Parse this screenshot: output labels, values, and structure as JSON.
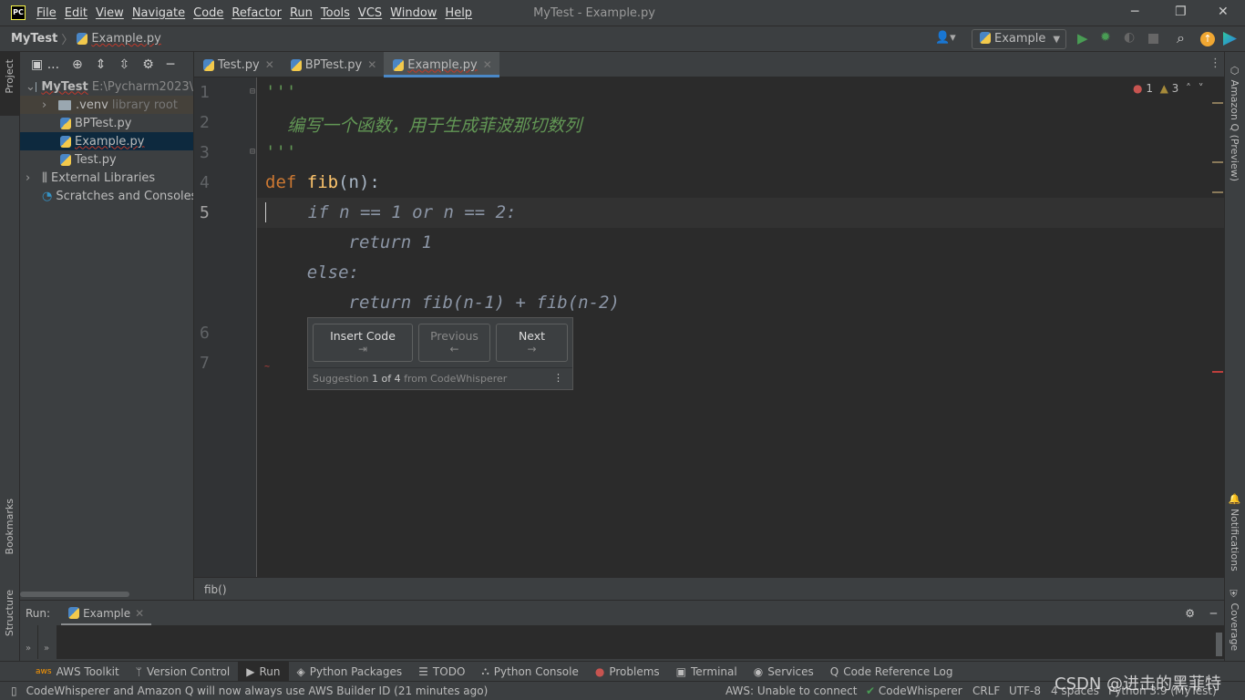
{
  "app": {
    "logo": "PC",
    "window_title": "MyTest - Example.py"
  },
  "menu": [
    "File",
    "Edit",
    "View",
    "Navigate",
    "Code",
    "Refactor",
    "Run",
    "Tools",
    "VCS",
    "Window",
    "Help"
  ],
  "nav": {
    "project": "MyTest",
    "file": "Example.py",
    "run_config": "Example"
  },
  "stripes": {
    "project": "Project",
    "bookmarks": "Bookmarks",
    "structure": "Structure",
    "amazonq": "Amazon Q (Preview)",
    "notifications": "Notifications",
    "coverage": "Coverage"
  },
  "project": {
    "header_more": "...",
    "root": "MyTest",
    "root_path": "E:\\Pycharm2023\\",
    "venv": ".venv",
    "venv_note": "library root",
    "files": [
      "BPTest.py",
      "Example.py",
      "Test.py"
    ],
    "external": "External Libraries",
    "scratches": "Scratches and Consoles"
  },
  "tabs": [
    "Test.py",
    "BPTest.py",
    "Example.py"
  ],
  "inspections": {
    "errors": "1",
    "warnings": "3"
  },
  "editor": {
    "line_numbers": [
      "1",
      "2",
      "3",
      "4",
      "5",
      "6",
      "7"
    ],
    "lines": {
      "l1": "'''",
      "l2": "    编写一个函数，用于生成菲波那切数列",
      "l3": "'''",
      "l4_kw": "def ",
      "l4_fn": "fib",
      "l4_rest": "(n):"
    },
    "ghost": [
      "    if n == 1 or n == 2:",
      "        return 1",
      "    else:",
      "        return fib(n-1) + fib(n-2)"
    ]
  },
  "popup": {
    "insert": "Insert Code",
    "insert_key": "⇥",
    "prev": "Previous",
    "prev_key": "←",
    "next": "Next",
    "next_key": "→",
    "footer_pre": "Suggestion ",
    "footer_count": "1 of 4",
    "footer_post": " from CodeWhisperer"
  },
  "breadcrumb": "fib()",
  "run": {
    "label": "Run:",
    "tab": "Example"
  },
  "toolwindows": [
    "AWS Toolkit",
    "Version Control",
    "Run",
    "Python Packages",
    "TODO",
    "Python Console",
    "Problems",
    "Terminal",
    "Services",
    "Code Reference Log"
  ],
  "status": {
    "message": "CodeWhisperer and Amazon Q will now always use AWS Builder ID (21 minutes ago)",
    "aws": "AWS: Unable to connect",
    "cw": "CodeWhisperer",
    "eol": "CRLF",
    "enc": "UTF-8",
    "indent": "4 spaces",
    "interp": "Python 3.9 (MyTest)",
    "watermark": "CSDN @进击的黑菲特"
  }
}
